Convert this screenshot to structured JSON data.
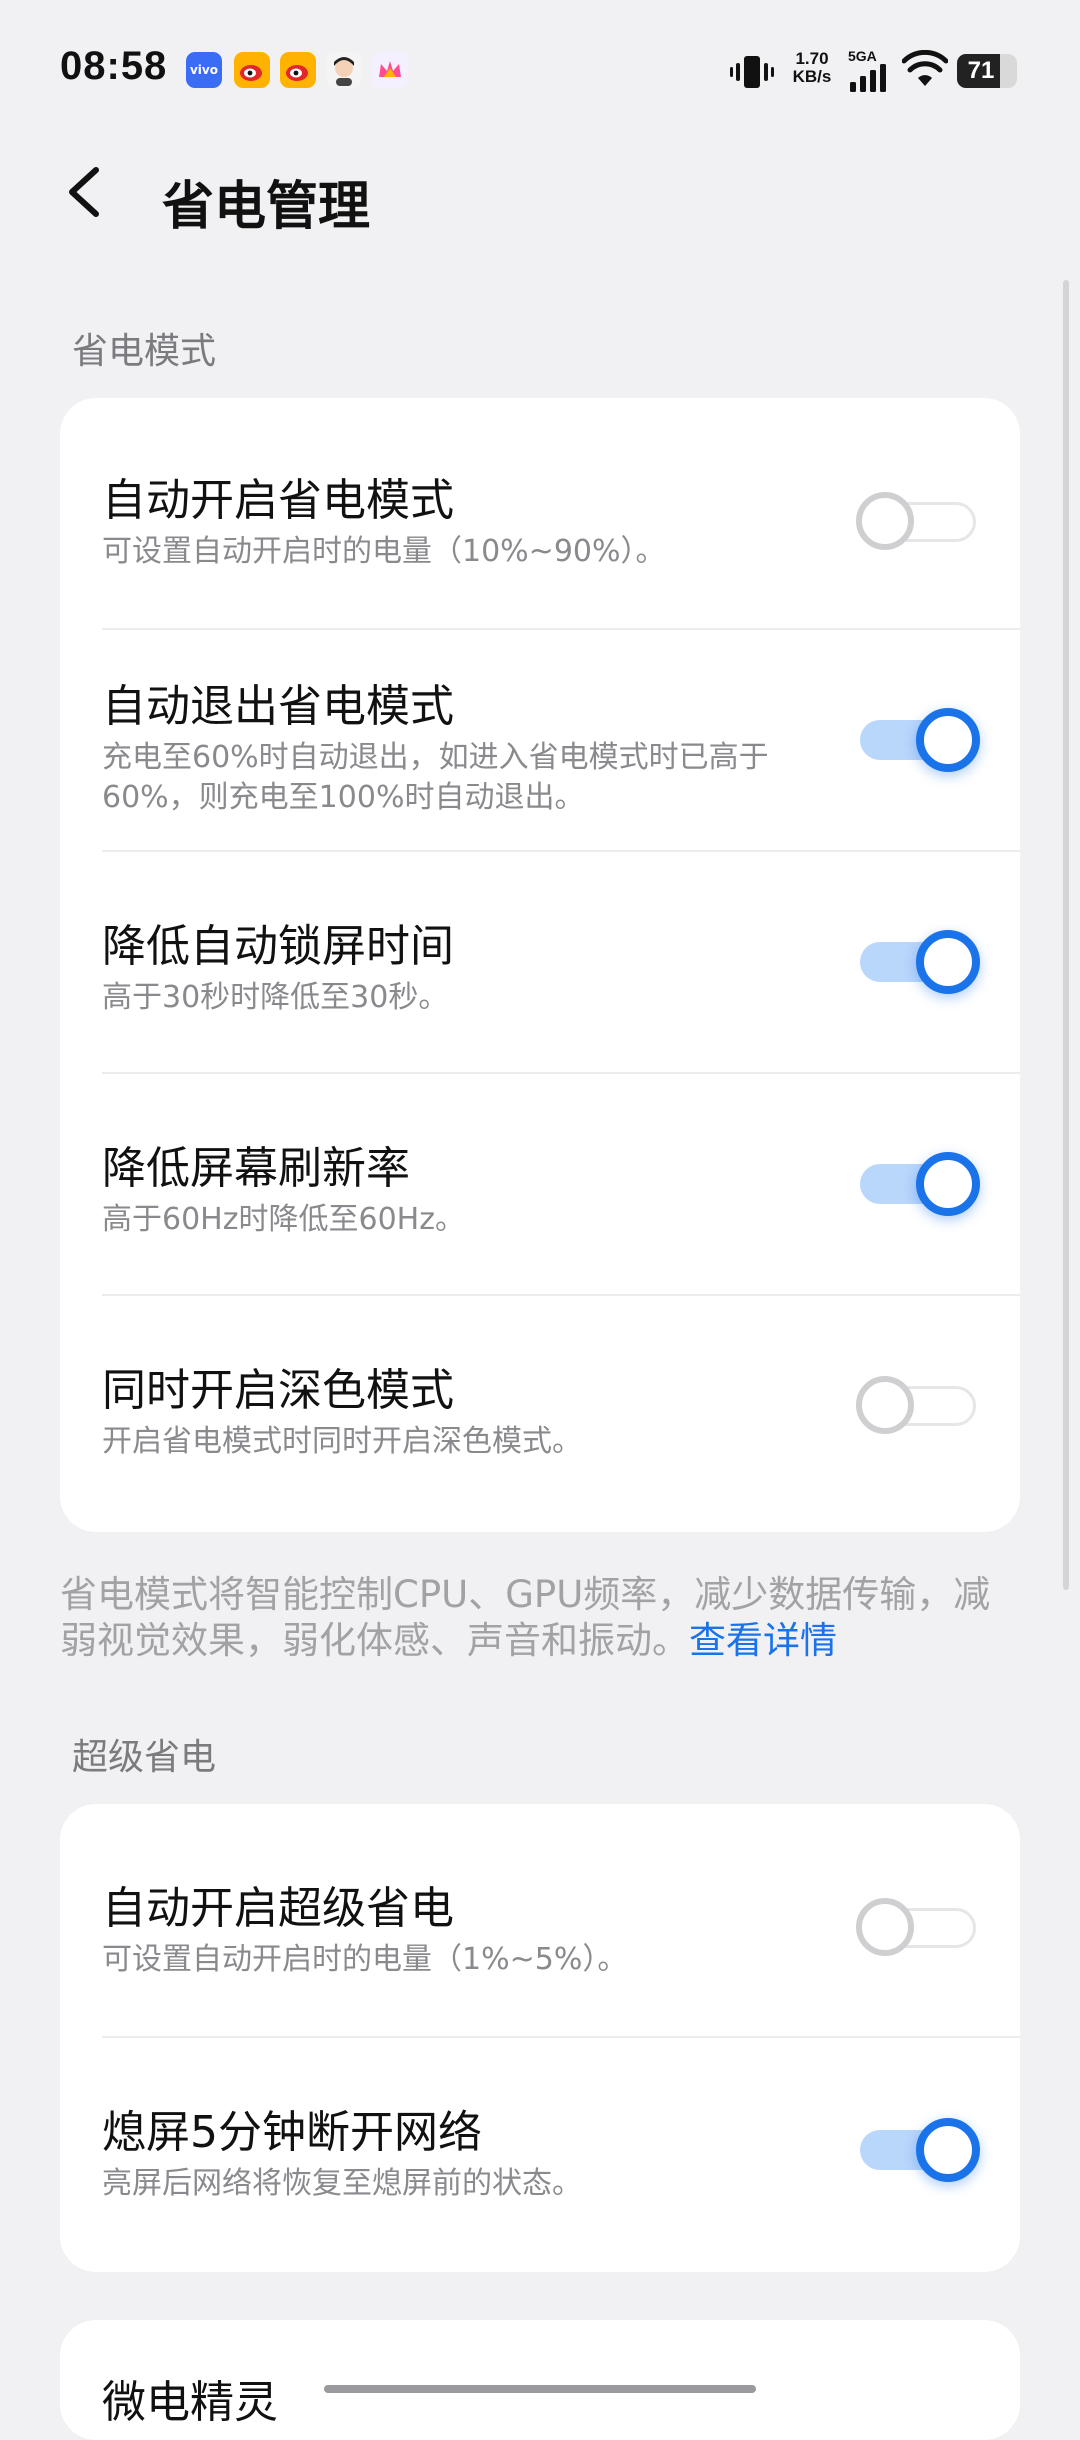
{
  "status_bar": {
    "time": "08:58",
    "app_icons": [
      {
        "name": "vivo-icon",
        "label": "vivo",
        "color": "#3b6cf5"
      },
      {
        "name": "weibo-icon",
        "label": "",
        "color": "#ffb300"
      },
      {
        "name": "weibo-icon-2",
        "label": "",
        "color": "#ffb300"
      },
      {
        "name": "avatar-app-icon",
        "label": "",
        "color": "#f0e4d8"
      },
      {
        "name": "crown-app-icon",
        "label": "",
        "color": "#f5f0ff"
      }
    ],
    "network_speed": "1.70",
    "network_unit": "KB/s",
    "signal_label": "5GA",
    "battery_level": "71",
    "battery_fraction": 0.71
  },
  "header": {
    "back_icon": "chevron-left-icon",
    "title": "省电管理"
  },
  "section_power_saving": {
    "label": "省电模式",
    "items": [
      {
        "title": "自动开启省电模式",
        "desc": "可设置自动开启时的电量（10%~90%）。",
        "enabled": false
      },
      {
        "title": "自动退出省电模式",
        "desc": "充电至60%时自动退出，如进入省电模式时已高于60%，则充电至100%时自动退出。",
        "enabled": true
      },
      {
        "title": "降低自动锁屏时间",
        "desc": "高于30秒时降低至30秒。",
        "enabled": true
      },
      {
        "title": "降低屏幕刷新率",
        "desc": "高于60Hz时降低至60Hz。",
        "enabled": true
      },
      {
        "title": "同时开启深色模式",
        "desc": "开启省电模式时同时开启深色模式。",
        "enabled": false
      }
    ],
    "note": "省电模式将智能控制CPU、GPU频率，减少数据传输，减弱视觉效果，弱化体感、声音和振动。",
    "note_link": "查看详情"
  },
  "section_super_saving": {
    "label": "超级省电",
    "items": [
      {
        "title": "自动开启超级省电",
        "desc": "可设置自动开启时的电量（1%~5%）。",
        "enabled": false
      },
      {
        "title": "熄屏5分钟断开网络",
        "desc": "亮屏后网络将恢复至熄屏前的状态。",
        "enabled": true
      }
    ]
  },
  "next_card": {
    "title": "微电精灵"
  },
  "colors": {
    "accent": "#1a73e8",
    "accent_track": "#b9d6fb",
    "background": "#f1f1f4",
    "card": "#ffffff"
  }
}
